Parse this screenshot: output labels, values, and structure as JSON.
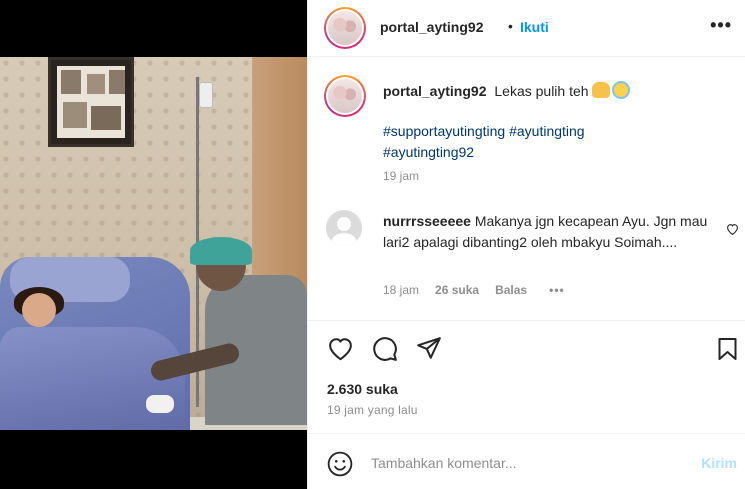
{
  "post": {
    "username": "portal_ayting92",
    "follow_label": "Ikuti",
    "dot": "•",
    "more_label": "•••"
  },
  "caption": {
    "username": "portal_ayting92",
    "text": "Lekas pulih teh",
    "hashtags": [
      "#supportayutingting",
      "#ayutingting",
      "#ayutingting92"
    ],
    "time": "19 jam"
  },
  "comment": {
    "username": "nurrrsseeeee",
    "text": "Makanya jgn kecapean Ayu. Jgn mau lari2 apalagi dibanting2 oleh mbakyu Soimah....",
    "time": "18 jam",
    "likes": "26 suka",
    "reply_label": "Balas",
    "more_label": "•••"
  },
  "stats": {
    "likes": "2.630 suka",
    "posted": "19 jam yang lalu"
  },
  "composer": {
    "placeholder": "Tambahkan komentar...",
    "send_label": "Kirim"
  },
  "icons": {
    "like": "heart-icon",
    "comment": "comment-icon",
    "share": "paper-plane-icon",
    "save": "bookmark-icon",
    "emoji": "smiley-icon"
  },
  "colors": {
    "accent": "#0095f6",
    "hashtag": "#00376b",
    "muted": "#8e8e8e",
    "send_disabled": "#b2dffc"
  }
}
